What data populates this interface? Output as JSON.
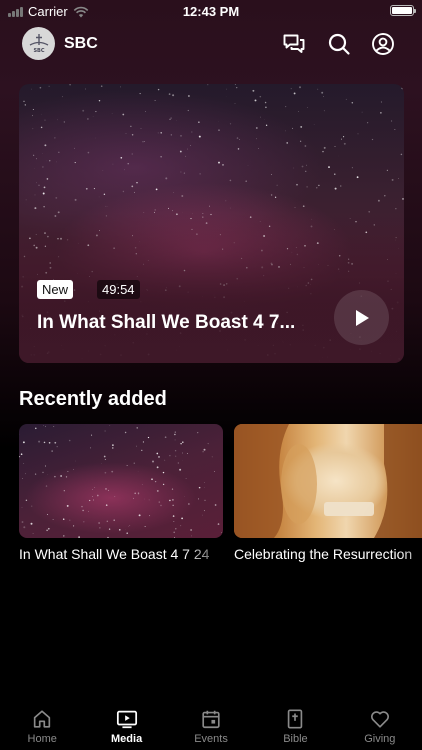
{
  "status_bar": {
    "carrier": "Carrier",
    "time": "12:43 PM"
  },
  "header": {
    "logo_text": "SBC",
    "church_name": "SBC",
    "icons": [
      "chat-icon",
      "search-icon",
      "account-icon"
    ]
  },
  "hero": {
    "badge": "New",
    "duration": "49:54",
    "title": "In What Shall We Boast 4 7..."
  },
  "recently_added": {
    "title": "Recently added",
    "items": [
      {
        "title": "In What Shall We Boast 4 7 24"
      },
      {
        "title": "Celebrating the Resurrection"
      }
    ]
  },
  "tab_bar": {
    "active": "Media",
    "tabs": [
      {
        "label": "Home",
        "icon": "home-icon"
      },
      {
        "label": "Media",
        "icon": "media-icon"
      },
      {
        "label": "Events",
        "icon": "calendar-icon"
      },
      {
        "label": "Bible",
        "icon": "bible-icon"
      },
      {
        "label": "Giving",
        "icon": "heart-icon"
      }
    ]
  },
  "colors": {
    "background_top": "#2d1120",
    "background_bottom": "#000000",
    "active_tab": "#ffffff",
    "inactive_tab": "#8a8a8a"
  }
}
